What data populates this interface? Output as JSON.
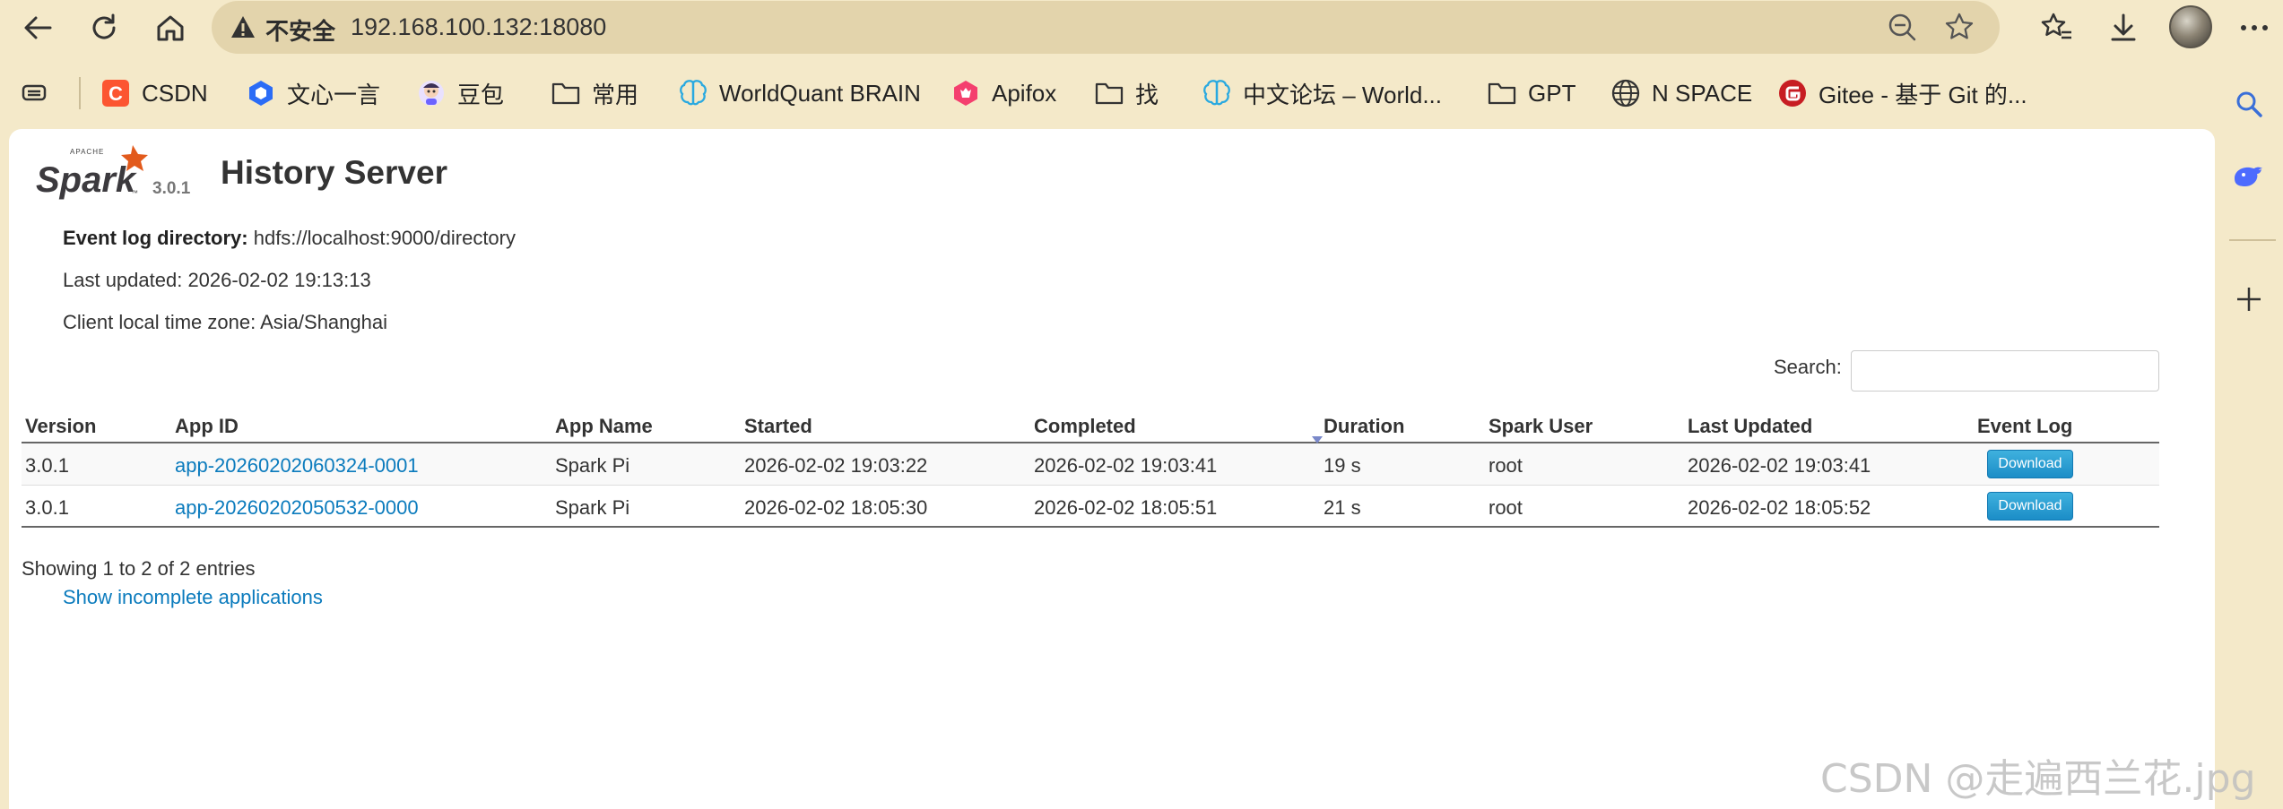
{
  "browser": {
    "address_bar": {
      "security_label": "不安全",
      "url": "192.168.100.132:18080"
    }
  },
  "bookmarks": [
    {
      "label": "",
      "icon": "tab-actions-icon"
    },
    {
      "label": "CSDN",
      "icon": "csdn-icon",
      "color": "#fc5531"
    },
    {
      "label": "文心一言",
      "icon": "wenxin-icon",
      "color": "#2b6cf6"
    },
    {
      "label": "豆包",
      "icon": "doubao-icon"
    },
    {
      "label": "常用",
      "icon": "folder-icon"
    },
    {
      "label": "WorldQuant BRAIN",
      "icon": "brain-icon",
      "color": "#29a9e0"
    },
    {
      "label": "Apifox",
      "icon": "apifox-icon",
      "color": "#f43f6e"
    },
    {
      "label": "找",
      "icon": "folder-icon"
    },
    {
      "label": "中文论坛 – World...",
      "icon": "brain-icon",
      "color": "#29a9e0"
    },
    {
      "label": "GPT",
      "icon": "folder-icon"
    },
    {
      "label": "N SPACE",
      "icon": "globe-icon"
    },
    {
      "label": "Gitee - 基于 Git 的...",
      "icon": "gitee-icon",
      "color": "#c71d23"
    }
  ],
  "page": {
    "spark_version": "3.0.1",
    "title": "History Server",
    "event_log_label": "Event log directory:",
    "event_log_value": "hdfs://localhost:9000/directory",
    "last_updated": "Last updated: 2026-02-02 19:13:13",
    "time_zone": "Client local time zone: Asia/Shanghai",
    "search_label": "Search:",
    "search_value": "",
    "table": {
      "headers": [
        "Version",
        "App ID",
        "App Name",
        "Started",
        "Completed",
        "Duration",
        "Spark User",
        "Last Updated",
        "Event Log"
      ],
      "rows": [
        {
          "version": "3.0.1",
          "app_id": "app-20260202060324-0001",
          "app_name": "Spark Pi",
          "started": "2026-02-02 19:03:22",
          "completed": "2026-02-02 19:03:41",
          "duration": "19 s",
          "user": "root",
          "last_updated": "2026-02-02 19:03:41",
          "event_log": "Download"
        },
        {
          "version": "3.0.1",
          "app_id": "app-20260202050532-0000",
          "app_name": "Spark Pi",
          "started": "2026-02-02 18:05:30",
          "completed": "2026-02-02 18:05:51",
          "duration": "21 s",
          "user": "root",
          "last_updated": "2026-02-02 18:05:52",
          "event_log": "Download"
        }
      ]
    },
    "entries_info": "Showing 1 to 2 of 2 entries",
    "incomplete_link": "Show incomplete applications"
  },
  "watermark": "CSDN @走遍西兰花.jpg"
}
